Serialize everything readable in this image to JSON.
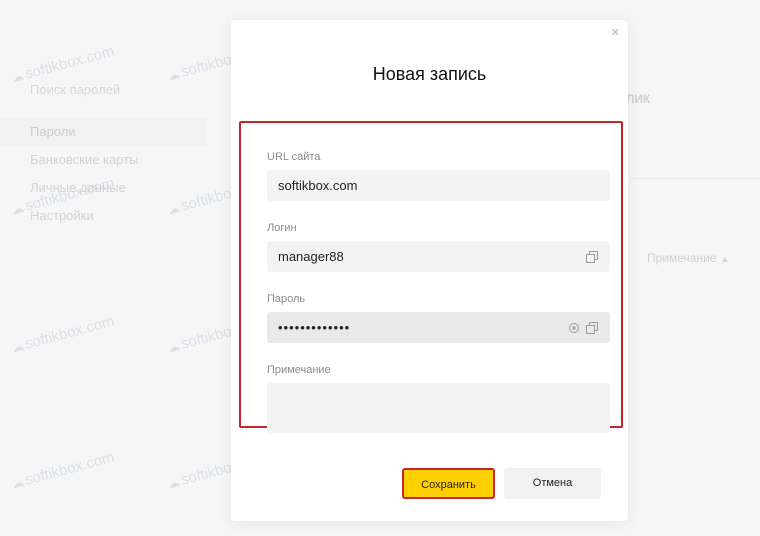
{
  "background": {
    "search_placeholder": "Поиск паролей",
    "nav_items": [
      "Пароли",
      "Банковские карты",
      "Личные данные",
      "Настройки"
    ],
    "column_header": "ЛИК",
    "sort_label": "Примечание"
  },
  "watermark": "softikbox.com",
  "dialog": {
    "title": "Новая запись",
    "close_icon": "close-icon",
    "fields": {
      "url": {
        "label": "URL сайта",
        "value": "softikbox.com"
      },
      "login": {
        "label": "Логин",
        "value": "manager88"
      },
      "password": {
        "label": "Пароль",
        "value": "•••••••••••••"
      },
      "note": {
        "label": "Примечание",
        "value": ""
      }
    },
    "buttons": {
      "save": "Сохранить",
      "cancel": "Отмена"
    }
  },
  "colors": {
    "accent_yellow": "#ffd000",
    "highlight_red": "#c8232e"
  }
}
